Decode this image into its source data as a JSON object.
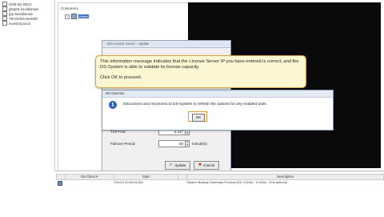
{
  "left_panel": {
    "items": [
      {
        "label": "DSM-2G-SEC2"
      },
      {
        "label": "gbop01.localdomain"
      },
      {
        "label": "gcp.localdomain"
      },
      {
        "label": "TRAINING-MAKER"
      },
      {
        "label": "Inventory.local"
      }
    ]
  },
  "customers_panel": {
    "title": "Customers",
    "tree": {
      "expander": "+",
      "label": "Admin"
    }
  },
  "bg_dialog": {
    "title": "DS-License Server - Update",
    "tcp_port_label": "TCP Port:",
    "tcp_port_value": "4,417",
    "failover_label": "Failover Period:",
    "failover_value": "60",
    "failover_unit": "minute(s)",
    "update_label": "Update",
    "cancel_label": "Cancel"
  },
  "info_dialog": {
    "title": "DS-Operator",
    "message": "Disconnect and reconnect to DS-System to refresh the options for any enabled tools.",
    "ok_label": "OK"
  },
  "callout": {
    "text": "This information message indicates that the License Server IP you have entered is correct, and the DS-System is able to validate its license capacity.",
    "text2": "Click OK to proceed."
  },
  "event_table": {
    "columns": [
      "",
      "DS-Client #",
      "Start",
      "",
      "Description"
    ],
    "rows": [
      {
        "client": "",
        "start": "7/24/19 10:50:25 AM",
        "description": "System Backup Summary Process (Ok 0.0Gbs - 0.0Gbs - One actions)"
      }
    ]
  },
  "colors": {
    "accent": "#3d6fc7",
    "callout_border": "#d4a43b",
    "callout_bg": "#fdf6d3",
    "highlight": "#e3942a",
    "dark_area": "#0a0a0a"
  }
}
